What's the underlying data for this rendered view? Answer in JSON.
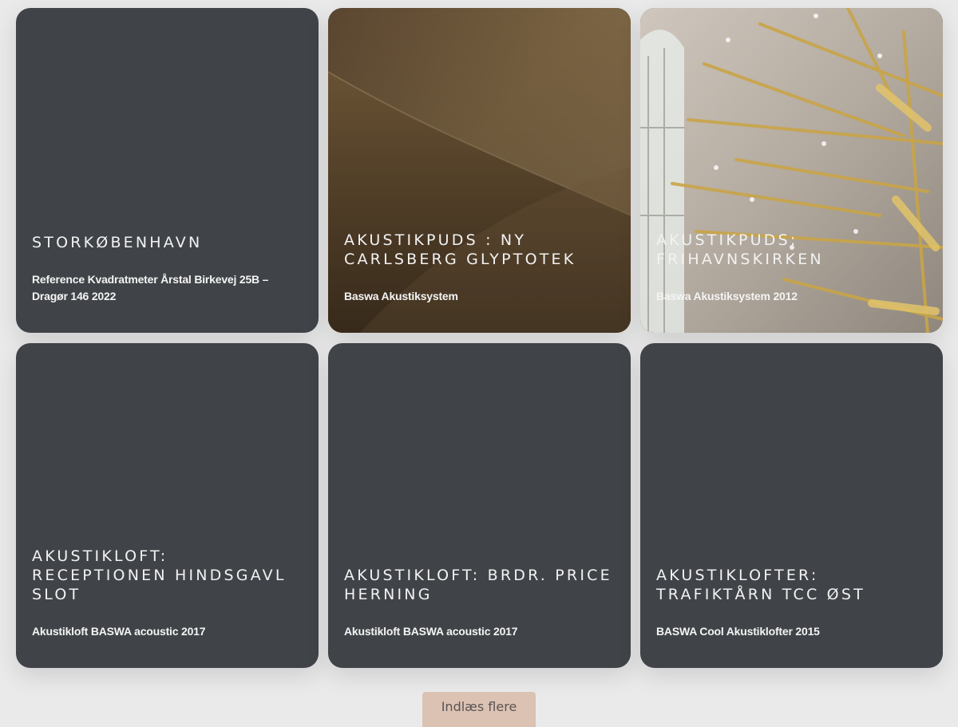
{
  "cards": [
    {
      "title": "Storkøbenhavn",
      "subtitle": "Reference Kvadratmeter Årstal Birkevej 25B – Dragør 146 2022",
      "image": "none"
    },
    {
      "title": "Akustikpuds : Ny Carlsberg Glyptotek",
      "subtitle": "Baswa Akustiksystem",
      "image": "brown-plaster-ceiling-curve"
    },
    {
      "title": "Akustikpuds: Frihavnskirken",
      "subtitle": "Baswa Akustiksystem 2012",
      "image": "church-interior-golden-chandelier"
    },
    {
      "title": "Akustikloft: Receptionen Hindsgavl Slot",
      "subtitle": "Akustikloft BASWA acoustic 2017",
      "image": "none"
    },
    {
      "title": "Akustikloft: Brdr. Price Herning",
      "subtitle": "Akustikloft BASWA acoustic 2017",
      "image": "none"
    },
    {
      "title": "Akustiklofter: Trafiktårn TCC Øst",
      "subtitle": "BASWA Cool Akustiklofter 2015",
      "image": "none"
    }
  ],
  "load_more_label": "Indlæs flere",
  "colors": {
    "card_background": "#404348",
    "page_background": "#eaeaea",
    "button_background": "#dcc2b3",
    "text": "#ffffff"
  }
}
